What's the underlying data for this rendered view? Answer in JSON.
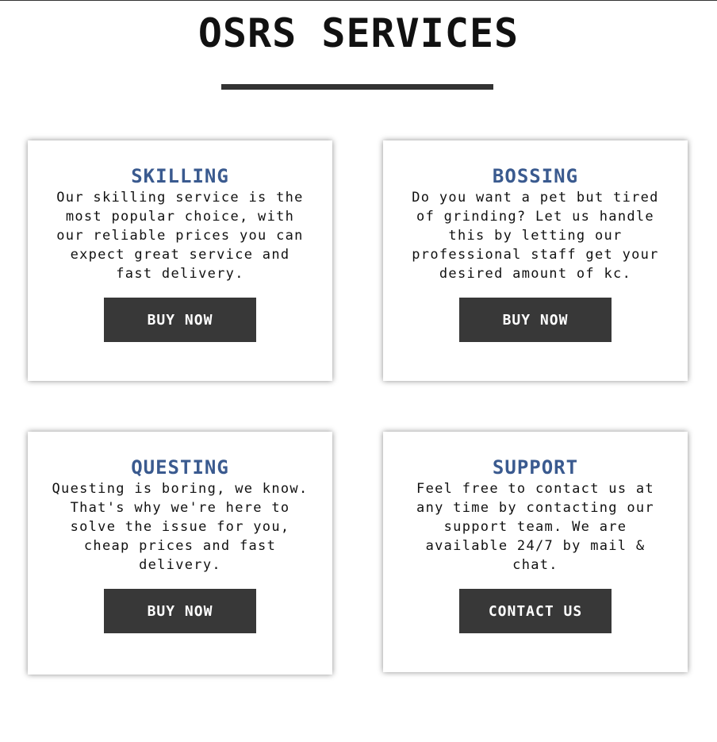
{
  "header": {
    "title": "OSRS SERVICES"
  },
  "services": [
    {
      "title": "SKILLING",
      "description": "Our skilling service is the most popular choice, with our reliable prices you can expect great service and fast delivery.",
      "button_label": "BUY NOW"
    },
    {
      "title": "BOSSING",
      "description": "Do you want a pet but tired of grinding? Let us handle this by letting our professional staff get your desired amount of kc.",
      "button_label": "BUY NOW"
    },
    {
      "title": "QUESTING",
      "description": "Questing is boring, we know. That's why we're here to solve the issue for you, cheap prices and fast delivery.",
      "button_label": "BUY NOW"
    },
    {
      "title": "SUPPORT",
      "description": "Feel free to contact us at any time by contacting our support team. We are available 24/7 by mail & chat.",
      "button_label": "CONTACT US"
    }
  ],
  "colors": {
    "card_title": "#3a5a8f",
    "button_bg": "#383838",
    "button_text": "#ffffff"
  }
}
